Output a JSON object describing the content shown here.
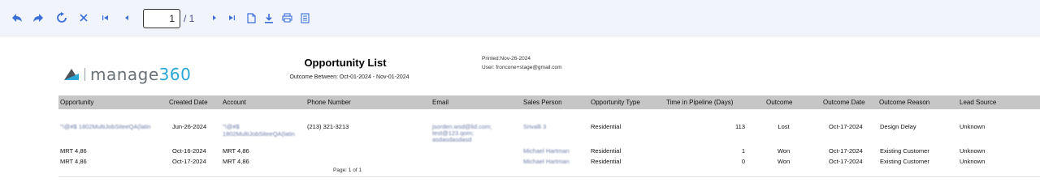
{
  "toolbar": {
    "current_page": "1",
    "total_pages": "/ 1"
  },
  "report": {
    "logo_text": "manage",
    "logo_num": "360",
    "title": "Opportunity List",
    "subtitle": "Outcome Between: Oct-01-2024 - Nov-01-2024",
    "printed": "Printed:Nov-26-2024",
    "user": "User: froncone+stage@gmail.com",
    "footer": "Page: 1 of 1"
  },
  "columns": [
    "Opportunity",
    "Created Date",
    "Account",
    "Phone Number",
    "Email",
    "Sales Person",
    "Opportunity Type",
    "Time in Pipeline (Days)",
    "Outcome",
    "Outcome Date",
    "Outcome Reason",
    "Lead Source"
  ],
  "rows": [
    {
      "opportunity": "\"!@#$ 1802MultiJobSiteeQA(latin",
      "created": "Jun-26-2024",
      "account_1": "\"!@#$",
      "account_2": "1802MultiJobSiteeQA(latin",
      "phone": "(213) 321-3213",
      "email_1": "jsorden.wsd@lid.com;",
      "email_2": "test@123.qom;",
      "email_3": "asdasdasdasd",
      "sales": "Srivalli 3",
      "type": "Residential",
      "days": "113",
      "outcome": "Lost",
      "outcome_date": "Oct-17-2024",
      "reason": "Design Delay",
      "lead": "Unknown"
    },
    {
      "opportunity": "MRT 4,86",
      "created": "Oct-16-2024",
      "account_1": "MRT 4,86",
      "phone": "",
      "sales": "Michael Hartman",
      "type": "Residential",
      "days": "1",
      "outcome": "Won",
      "outcome_date": "Oct-17-2024",
      "reason": "Existing Customer",
      "lead": "Unknown"
    },
    {
      "opportunity": "MRT 4,86",
      "created": "Oct-17-2024",
      "account_1": "MRT 4,86",
      "phone": "",
      "sales": "Michael Hartman",
      "type": "Residential",
      "days": "0",
      "outcome": "Won",
      "outcome_date": "Oct-17-2024",
      "reason": "Existing Customer",
      "lead": "Unknown"
    }
  ]
}
